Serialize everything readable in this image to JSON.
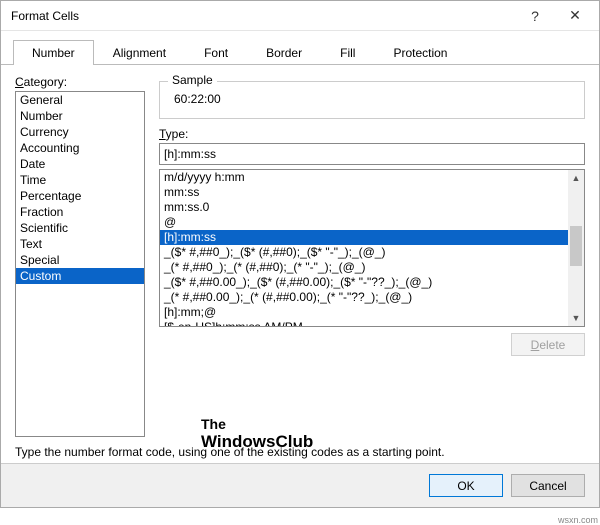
{
  "window": {
    "title": "Format Cells",
    "help": "?",
    "close": "✕"
  },
  "tabs": [
    {
      "label": "Number"
    },
    {
      "label": "Alignment"
    },
    {
      "label": "Font"
    },
    {
      "label": "Border"
    },
    {
      "label": "Fill"
    },
    {
      "label": "Protection"
    }
  ],
  "active_tab": 0,
  "category_label": "Category:",
  "categories": [
    "General",
    "Number",
    "Currency",
    "Accounting",
    "Date",
    "Time",
    "Percentage",
    "Fraction",
    "Scientific",
    "Text",
    "Special",
    "Custom"
  ],
  "selected_category": 11,
  "sample": {
    "legend": "Sample",
    "value": "60:22:00"
  },
  "type_label": "Type:",
  "type_value": "[h]:mm:ss",
  "type_list": [
    "m/d/yyyy h:mm",
    "mm:ss",
    "mm:ss.0",
    "@",
    "[h]:mm:ss",
    "_($* #,##0_);_($* (#,##0);_($* \"-\"_);_(@_)",
    "_(* #,##0_);_(* (#,##0);_(* \"-\"_);_(@_)",
    "_($* #,##0.00_);_($* (#,##0.00);_($* \"-\"??_);_(@_)",
    "_(* #,##0.00_);_(* (#,##0.00);_(* \"-\"??_);_(@_)",
    "[h]:mm;@",
    "[$-en-US]h:mm:ss AM/PM"
  ],
  "selected_type": 4,
  "delete_label": "Delete",
  "hint": "Type the number format code, using one of the existing codes as a starting point.",
  "buttons": {
    "ok": "OK",
    "cancel": "Cancel"
  },
  "watermark": {
    "line1": "The",
    "line2": "WindowsClub"
  },
  "corner": "wsxn.com"
}
